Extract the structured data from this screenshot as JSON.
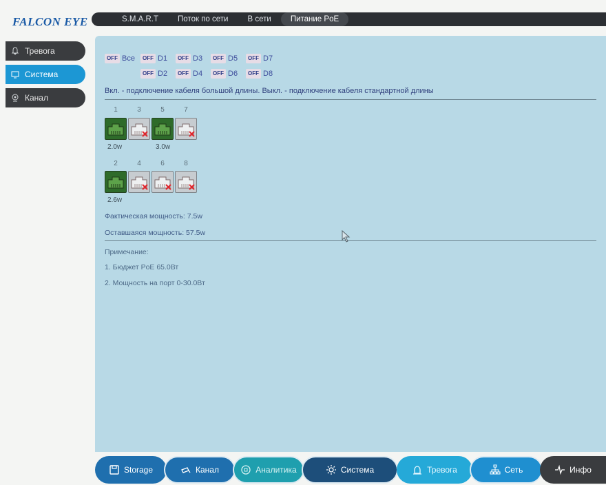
{
  "logo": "FALCON EYE",
  "tabs": [
    {
      "label": "S.M.A.R.T"
    },
    {
      "label": "Поток по сети"
    },
    {
      "label": "В сети"
    },
    {
      "label": "Питание PoE"
    }
  ],
  "sidebar": {
    "items": [
      {
        "label": "Тревога"
      },
      {
        "label": "Система"
      },
      {
        "label": "Канал"
      }
    ]
  },
  "poe": {
    "off_label": "OFF",
    "toggles": {
      "all": "Все",
      "d1": "D1",
      "d2": "D2",
      "d3": "D3",
      "d4": "D4",
      "d5": "D5",
      "d6": "D6",
      "d7": "D7",
      "d8": "D8"
    },
    "description": "Вкл. - подключение кабеля большой длины. Выкл. - подключение кабеля стандартной длины",
    "ports_top": [
      {
        "num": "1",
        "power": "2.0w",
        "status": "on"
      },
      {
        "num": "3",
        "power": "",
        "status": "off"
      },
      {
        "num": "5",
        "power": "3.0w",
        "status": "on"
      },
      {
        "num": "7",
        "power": "",
        "status": "off"
      }
    ],
    "ports_bottom": [
      {
        "num": "2",
        "power": "2.6w",
        "status": "on"
      },
      {
        "num": "4",
        "power": "",
        "status": "off"
      },
      {
        "num": "6",
        "power": "",
        "status": "off"
      },
      {
        "num": "8",
        "power": "",
        "status": "off"
      }
    ],
    "actual_power": "Фактическая мощность: 7.5w",
    "remaining_power": "Оставшаяся мощность: 57.5w",
    "note_title": "Примечание:",
    "note_1": "1. Бюджет PoE 65.0Вт",
    "note_2": "2. Мощность на порт 0-30.0Вт"
  },
  "bottom_nav": [
    {
      "label": "Storage",
      "icon": "save-icon",
      "color": "#1f6fae"
    },
    {
      "label": "Канал",
      "icon": "camera-icon",
      "color": "#1f6fae"
    },
    {
      "label": "Аналитика",
      "icon": "analytics-icon",
      "color": "#1f9fae"
    },
    {
      "label": "Система",
      "icon": "gear-icon",
      "color": "#1d4e7a"
    },
    {
      "label": "Тревога",
      "icon": "alarm-icon",
      "color": "#25a9d8"
    },
    {
      "label": "Сеть",
      "icon": "network-icon",
      "color": "#1f8fd0"
    },
    {
      "label": "Инфо",
      "icon": "pulse-icon",
      "color": "#3a3c3f"
    }
  ]
}
